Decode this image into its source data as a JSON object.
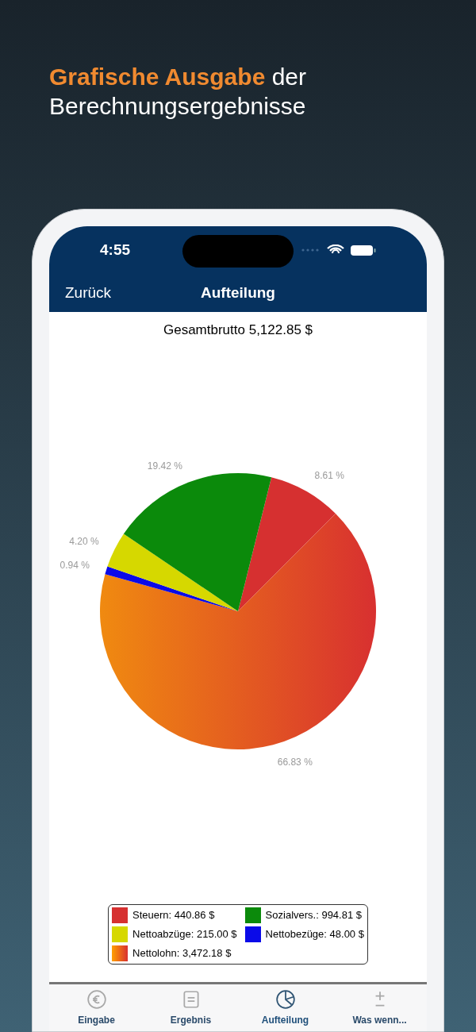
{
  "headline": "**Grafische Ausgabe** der Berechnungsergebnisse",
  "status_bar": {
    "time": "4:55"
  },
  "nav_bar": {
    "back": "Zurück",
    "title": "Aufteilung"
  },
  "total": "Gesamtbrutto 5,122.85 $",
  "chart_data": {
    "type": "pie",
    "values": [
      8.61,
      66.83,
      0.94,
      4.2,
      19.42
    ],
    "colors": [
      "#d63030",
      "#f08a10",
      "#0a0ae8",
      "#d6d800",
      "#0b8a0b"
    ],
    "value_labels": [
      "8.61 %",
      "66.83 %",
      "0.94 %",
      "4.20 %",
      "19.42 %"
    ]
  },
  "legend": [
    {
      "label": "Steuern: 440.86 $",
      "color": "#d63030",
      "kind": "solid"
    },
    {
      "label": "Sozialvers.: 994.81 $",
      "color": "#0b8a0b",
      "kind": "solid"
    },
    {
      "label": "Nettoabzüge: 215.00 $",
      "color": "#d6d800",
      "kind": "solid"
    },
    {
      "label": "Nettobezüge: 48.00 $",
      "color": "#0a0ae8",
      "kind": "solid"
    },
    {
      "label": "Nettolohn: 3,472.18 $",
      "kind": "gradient"
    }
  ],
  "tabs": [
    {
      "label": "Eingabe",
      "kind": "euro",
      "selected": false
    },
    {
      "label": "Ergebnis",
      "kind": "document",
      "selected": false
    },
    {
      "label": "Aufteilung",
      "kind": "pie",
      "selected": true
    },
    {
      "label": "Was wenn...",
      "kind": "plusminus",
      "selected": false
    }
  ]
}
